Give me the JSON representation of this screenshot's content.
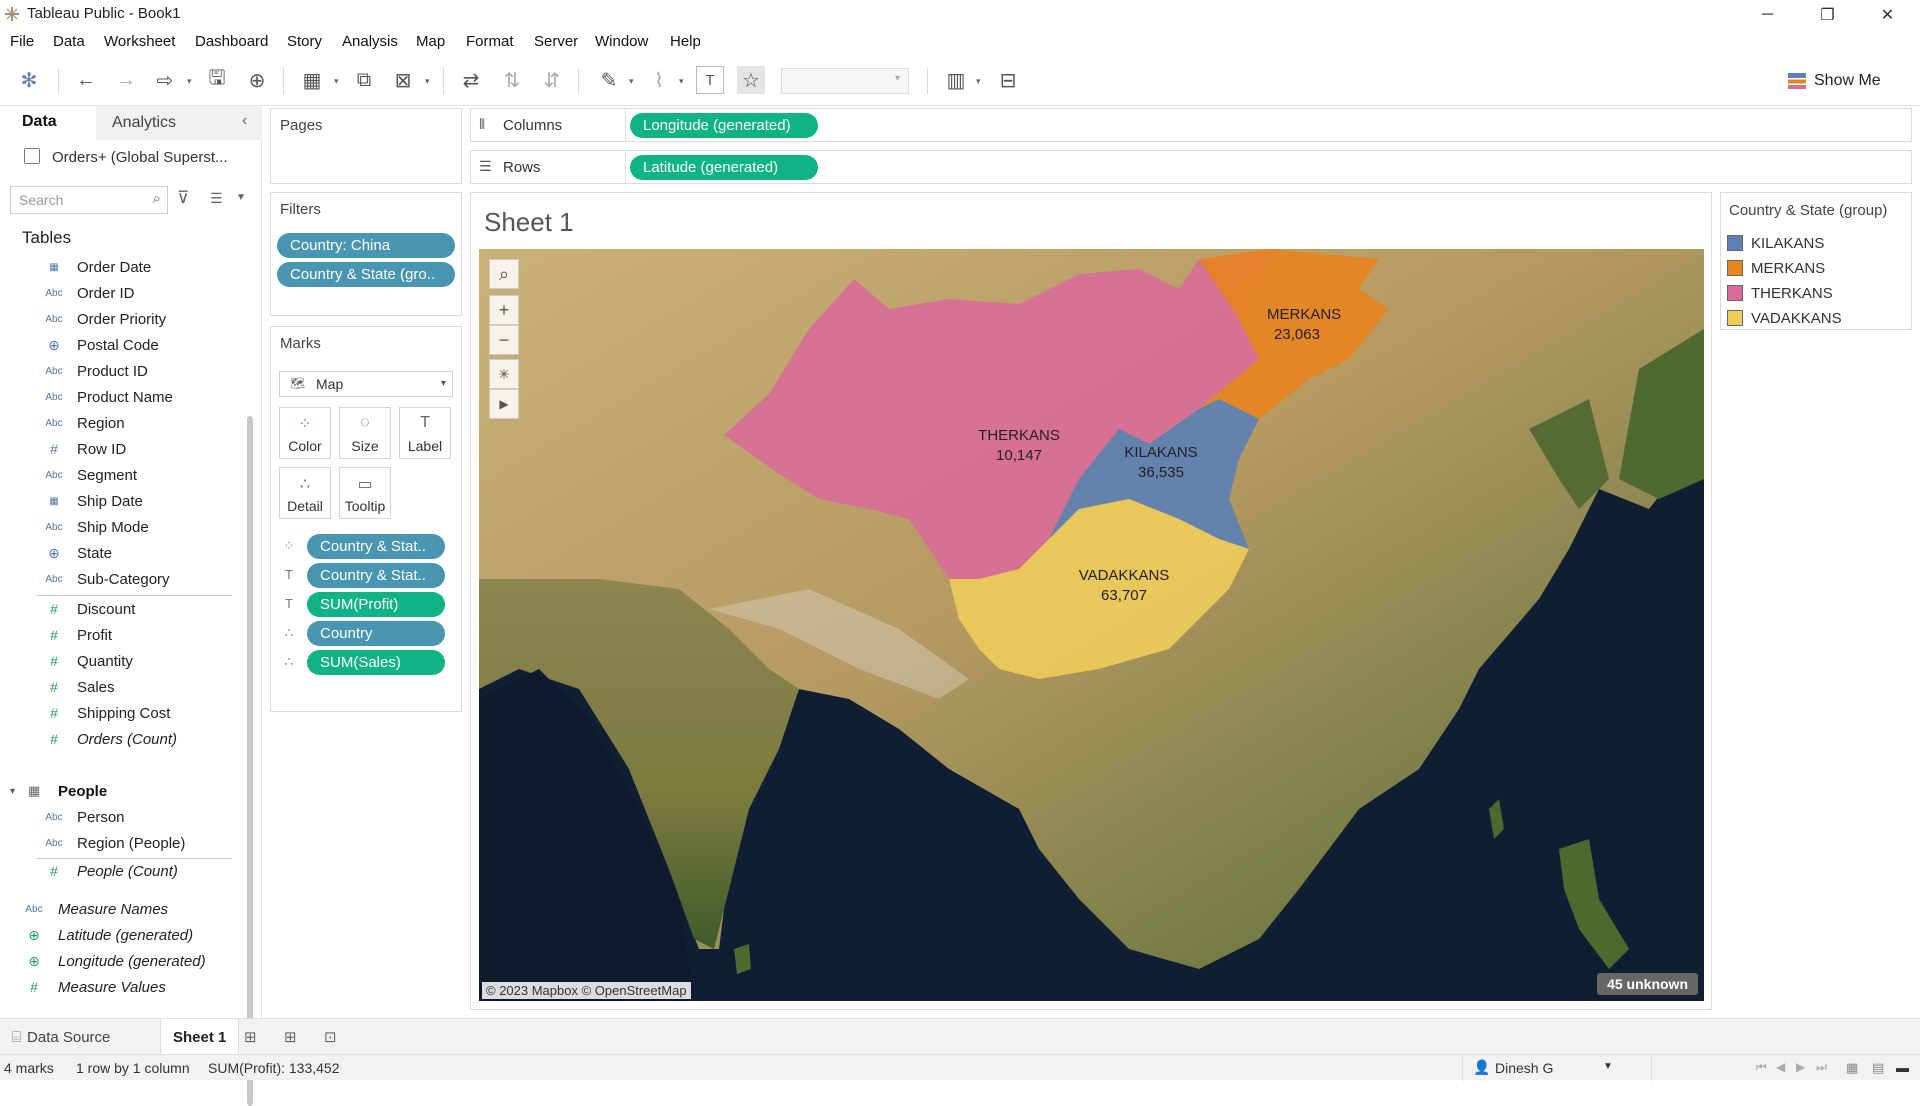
{
  "window": {
    "title": "Tableau Public - Book1"
  },
  "menu": [
    "File",
    "Data",
    "Worksheet",
    "Dashboard",
    "Story",
    "Analysis",
    "Map",
    "Format",
    "Server",
    "Window",
    "Help"
  ],
  "toolbar": {
    "show_me": "Show Me"
  },
  "data_pane": {
    "tabs": [
      "Data",
      "Analytics"
    ],
    "datasource": "Orders+ (Global Superst...",
    "search_placeholder": "Search",
    "tables_heading": "Tables",
    "orders_fields": [
      {
        "icon": "date",
        "name": "Order Date"
      },
      {
        "icon": "Abc",
        "name": "Order ID"
      },
      {
        "icon": "Abc",
        "name": "Order Priority"
      },
      {
        "icon": "globe",
        "name": "Postal Code"
      },
      {
        "icon": "Abc",
        "name": "Product ID"
      },
      {
        "icon": "Abc",
        "name": "Product Name"
      },
      {
        "icon": "Abc",
        "name": "Region"
      },
      {
        "icon": "#",
        "name": "Row ID"
      },
      {
        "icon": "Abc",
        "name": "Segment"
      },
      {
        "icon": "date",
        "name": "Ship Date"
      },
      {
        "icon": "Abc",
        "name": "Ship Mode"
      },
      {
        "icon": "globe",
        "name": "State"
      },
      {
        "icon": "Abc",
        "name": "Sub-Category"
      }
    ],
    "orders_measures": [
      "Discount",
      "Profit",
      "Quantity",
      "Sales",
      "Shipping Cost",
      "Orders (Count)"
    ],
    "people_table": "People",
    "people_fields": [
      "Person",
      "Region (People)"
    ],
    "people_count": "People (Count)",
    "extra_fields": [
      "Measure Names",
      "Latitude (generated)",
      "Longitude (generated)",
      "Measure Values"
    ]
  },
  "pages": {
    "title": "Pages"
  },
  "filters": {
    "title": "Filters",
    "items": [
      "Country: China",
      "Country & State (gro.."
    ]
  },
  "marks": {
    "title": "Marks",
    "type": "Map",
    "buttons": [
      "Color",
      "Size",
      "Label",
      "Detail",
      "Tooltip"
    ],
    "pills": [
      {
        "role": "color",
        "label": "Country & Stat.."
      },
      {
        "role": "label",
        "label": "Country & Stat.."
      },
      {
        "role": "label",
        "label": "SUM(Profit)"
      },
      {
        "role": "detail",
        "label": "Country"
      },
      {
        "role": "detail",
        "label": "SUM(Sales)"
      }
    ]
  },
  "shelves": {
    "columns_label": "Columns",
    "columns_pill": "Longitude (generated)",
    "rows_label": "Rows",
    "rows_pill": "Latitude (generated)"
  },
  "sheet": {
    "title": "Sheet 1",
    "regions": [
      {
        "name": "MERKANS",
        "value": "23,063",
        "color": "#e8841f"
      },
      {
        "name": "THERKANS",
        "value": "10,147",
        "color": "#d96b9a"
      },
      {
        "name": "KILAKANS",
        "value": "36,535",
        "color": "#5b7fb6"
      },
      {
        "name": "VADAKKANS",
        "value": "63,707",
        "color": "#efcc5a"
      }
    ],
    "attribution": "© 2023 Mapbox © OpenStreetMap",
    "unknown": "45 unknown"
  },
  "legend": {
    "title": "Country & State (group)",
    "items": [
      {
        "name": "KILAKANS",
        "color": "#4e79a7"
      },
      {
        "name": "MERKANS",
        "color": "#f28e2b"
      },
      {
        "name": "THERKANS",
        "color": "#e15759"
      },
      {
        "name": "VADAKKANS",
        "color": "#f1ce63"
      }
    ]
  },
  "tabs": {
    "data_source": "Data Source",
    "sheet1": "Sheet 1"
  },
  "status": {
    "marks": "4 marks",
    "dims": "1 row by 1 column",
    "sum": "SUM(Profit): 133,452",
    "user": "Dinesh G"
  }
}
